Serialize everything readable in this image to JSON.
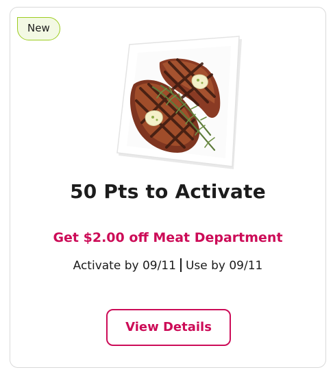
{
  "badge": {
    "label": "New"
  },
  "image": {
    "subject": "grilled-steaks-on-plate"
  },
  "offer": {
    "title": "50 Pts to Activate",
    "description": "Get $2.00 off Meat Department",
    "activate_by": "Activate by 09/11",
    "use_by": "Use by 09/11"
  },
  "actions": {
    "view_details_label": "View Details"
  },
  "colors": {
    "accent": "#cc0b57",
    "badge_border": "#9ccc1f",
    "badge_bg": "#f3f9e4",
    "card_border": "#d9d9d9"
  }
}
